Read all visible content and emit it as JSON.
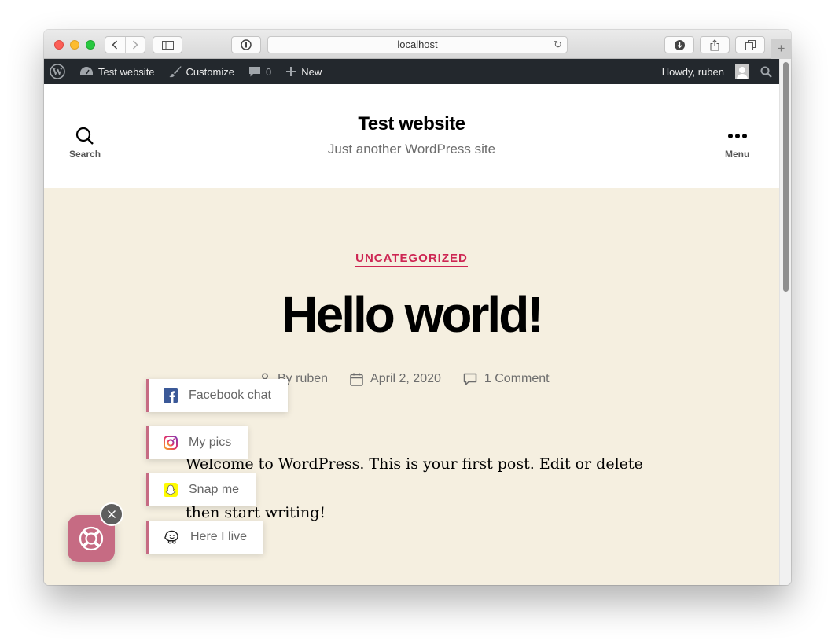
{
  "browser": {
    "url": "localhost"
  },
  "adminbar": {
    "site_name": "Test website",
    "customize": "Customize",
    "comments_count": "0",
    "new_label": "New",
    "howdy": "Howdy, ruben"
  },
  "header": {
    "site_title": "Test website",
    "tagline": "Just another WordPress site",
    "search_label": "Search",
    "menu_label": "Menu"
  },
  "post": {
    "category": "UNCATEGORIZED",
    "title": "Hello world!",
    "author": "By ruben",
    "date": "April 2, 2020",
    "comments": "1 Comment",
    "excerpt_line1": "Welcome to WordPress. This is your first post. Edit or delete it,",
    "excerpt_line2": "then start writing!"
  },
  "chat_widget": {
    "items": [
      {
        "label": "Facebook chat",
        "icon": "facebook-icon"
      },
      {
        "label": "My pics",
        "icon": "instagram-icon"
      },
      {
        "label": "Snap me",
        "icon": "snapchat-icon"
      },
      {
        "label": "Here I live",
        "icon": "waze-icon"
      }
    ],
    "accent_color": "#c66b83"
  },
  "colors": {
    "adminbar_bg": "#23282d",
    "content_bg": "#f5efe0",
    "category_color": "#cd2653"
  }
}
